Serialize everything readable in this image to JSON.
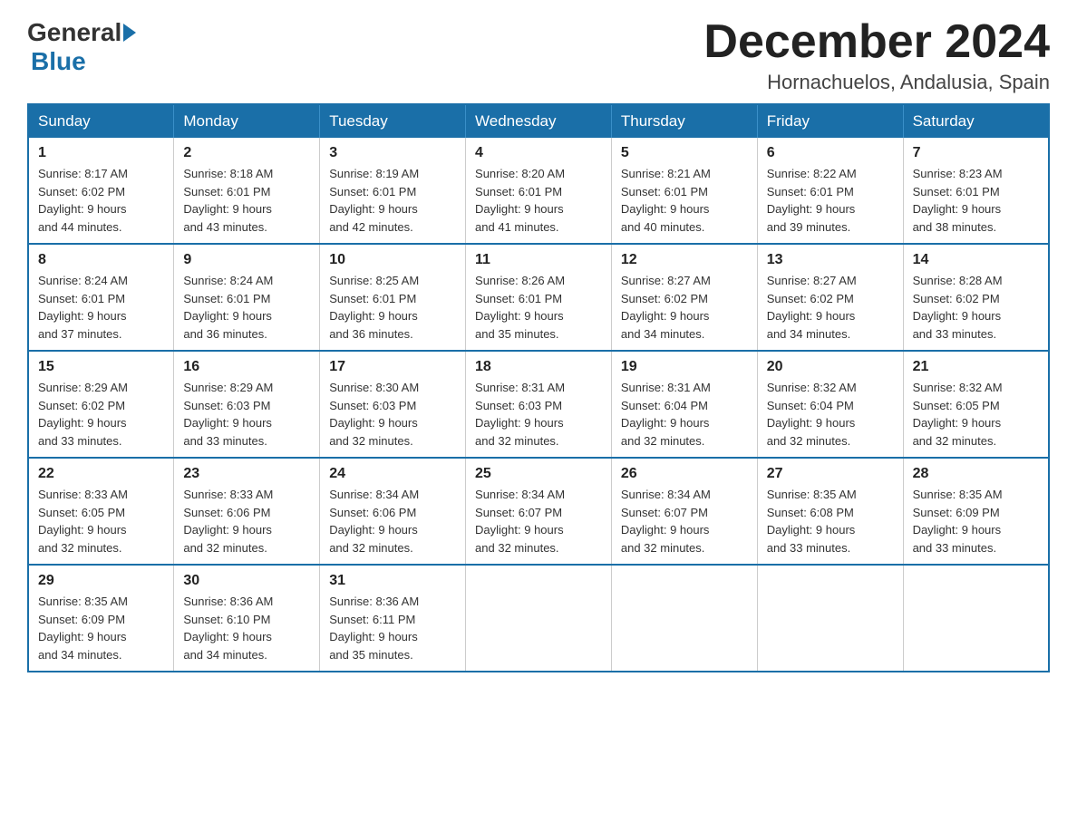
{
  "header": {
    "logo": {
      "general": "General",
      "blue": "Blue"
    },
    "title": "December 2024",
    "location": "Hornachuelos, Andalusia, Spain"
  },
  "weekdays": [
    "Sunday",
    "Monday",
    "Tuesday",
    "Wednesday",
    "Thursday",
    "Friday",
    "Saturday"
  ],
  "weeks": [
    [
      {
        "day": "1",
        "sunrise": "8:17 AM",
        "sunset": "6:02 PM",
        "daylight": "9 hours and 44 minutes."
      },
      {
        "day": "2",
        "sunrise": "8:18 AM",
        "sunset": "6:01 PM",
        "daylight": "9 hours and 43 minutes."
      },
      {
        "day": "3",
        "sunrise": "8:19 AM",
        "sunset": "6:01 PM",
        "daylight": "9 hours and 42 minutes."
      },
      {
        "day": "4",
        "sunrise": "8:20 AM",
        "sunset": "6:01 PM",
        "daylight": "9 hours and 41 minutes."
      },
      {
        "day": "5",
        "sunrise": "8:21 AM",
        "sunset": "6:01 PM",
        "daylight": "9 hours and 40 minutes."
      },
      {
        "day": "6",
        "sunrise": "8:22 AM",
        "sunset": "6:01 PM",
        "daylight": "9 hours and 39 minutes."
      },
      {
        "day": "7",
        "sunrise": "8:23 AM",
        "sunset": "6:01 PM",
        "daylight": "9 hours and 38 minutes."
      }
    ],
    [
      {
        "day": "8",
        "sunrise": "8:24 AM",
        "sunset": "6:01 PM",
        "daylight": "9 hours and 37 minutes."
      },
      {
        "day": "9",
        "sunrise": "8:24 AM",
        "sunset": "6:01 PM",
        "daylight": "9 hours and 36 minutes."
      },
      {
        "day": "10",
        "sunrise": "8:25 AM",
        "sunset": "6:01 PM",
        "daylight": "9 hours and 36 minutes."
      },
      {
        "day": "11",
        "sunrise": "8:26 AM",
        "sunset": "6:01 PM",
        "daylight": "9 hours and 35 minutes."
      },
      {
        "day": "12",
        "sunrise": "8:27 AM",
        "sunset": "6:02 PM",
        "daylight": "9 hours and 34 minutes."
      },
      {
        "day": "13",
        "sunrise": "8:27 AM",
        "sunset": "6:02 PM",
        "daylight": "9 hours and 34 minutes."
      },
      {
        "day": "14",
        "sunrise": "8:28 AM",
        "sunset": "6:02 PM",
        "daylight": "9 hours and 33 minutes."
      }
    ],
    [
      {
        "day": "15",
        "sunrise": "8:29 AM",
        "sunset": "6:02 PM",
        "daylight": "9 hours and 33 minutes."
      },
      {
        "day": "16",
        "sunrise": "8:29 AM",
        "sunset": "6:03 PM",
        "daylight": "9 hours and 33 minutes."
      },
      {
        "day": "17",
        "sunrise": "8:30 AM",
        "sunset": "6:03 PM",
        "daylight": "9 hours and 32 minutes."
      },
      {
        "day": "18",
        "sunrise": "8:31 AM",
        "sunset": "6:03 PM",
        "daylight": "9 hours and 32 minutes."
      },
      {
        "day": "19",
        "sunrise": "8:31 AM",
        "sunset": "6:04 PM",
        "daylight": "9 hours and 32 minutes."
      },
      {
        "day": "20",
        "sunrise": "8:32 AM",
        "sunset": "6:04 PM",
        "daylight": "9 hours and 32 minutes."
      },
      {
        "day": "21",
        "sunrise": "8:32 AM",
        "sunset": "6:05 PM",
        "daylight": "9 hours and 32 minutes."
      }
    ],
    [
      {
        "day": "22",
        "sunrise": "8:33 AM",
        "sunset": "6:05 PM",
        "daylight": "9 hours and 32 minutes."
      },
      {
        "day": "23",
        "sunrise": "8:33 AM",
        "sunset": "6:06 PM",
        "daylight": "9 hours and 32 minutes."
      },
      {
        "day": "24",
        "sunrise": "8:34 AM",
        "sunset": "6:06 PM",
        "daylight": "9 hours and 32 minutes."
      },
      {
        "day": "25",
        "sunrise": "8:34 AM",
        "sunset": "6:07 PM",
        "daylight": "9 hours and 32 minutes."
      },
      {
        "day": "26",
        "sunrise": "8:34 AM",
        "sunset": "6:07 PM",
        "daylight": "9 hours and 32 minutes."
      },
      {
        "day": "27",
        "sunrise": "8:35 AM",
        "sunset": "6:08 PM",
        "daylight": "9 hours and 33 minutes."
      },
      {
        "day": "28",
        "sunrise": "8:35 AM",
        "sunset": "6:09 PM",
        "daylight": "9 hours and 33 minutes."
      }
    ],
    [
      {
        "day": "29",
        "sunrise": "8:35 AM",
        "sunset": "6:09 PM",
        "daylight": "9 hours and 34 minutes."
      },
      {
        "day": "30",
        "sunrise": "8:36 AM",
        "sunset": "6:10 PM",
        "daylight": "9 hours and 34 minutes."
      },
      {
        "day": "31",
        "sunrise": "8:36 AM",
        "sunset": "6:11 PM",
        "daylight": "9 hours and 35 minutes."
      },
      null,
      null,
      null,
      null
    ]
  ]
}
